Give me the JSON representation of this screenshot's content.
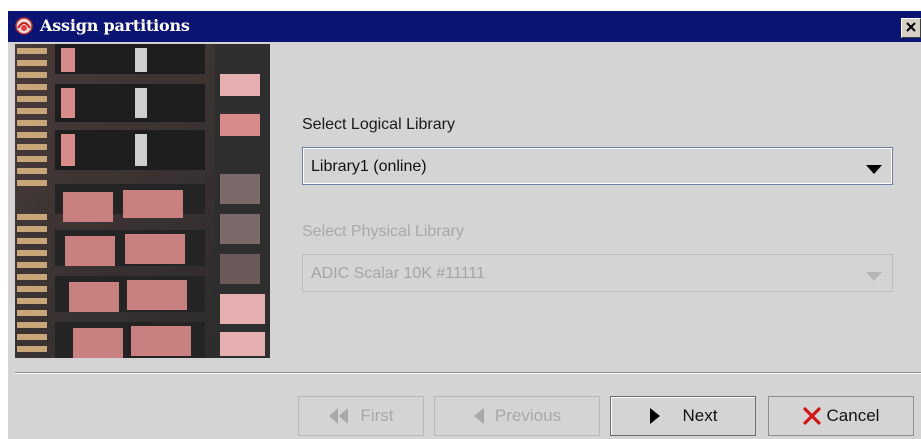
{
  "window": {
    "title": "Assign partitions",
    "titlebar_color": "#0b1472"
  },
  "logical": {
    "label": "Select Logical Library",
    "selected": "Library1 (online)",
    "enabled": true
  },
  "physical": {
    "label": "Select Physical Library",
    "selected": "ADIC Scalar 10K #11111",
    "enabled": false
  },
  "buttons": {
    "first": {
      "label": "First",
      "icon": "double-left-arrow-icon",
      "enabled": false
    },
    "previous": {
      "label": "Previous",
      "icon": "left-arrow-icon",
      "enabled": false
    },
    "next": {
      "label": "Next",
      "icon": "right-arrow-icon",
      "enabled": true
    },
    "cancel": {
      "label": "Cancel",
      "icon": "red-x-icon",
      "enabled": true
    }
  },
  "colors": {
    "cancel_x": "#d01818",
    "disabled_text": "#a9a9a9"
  }
}
